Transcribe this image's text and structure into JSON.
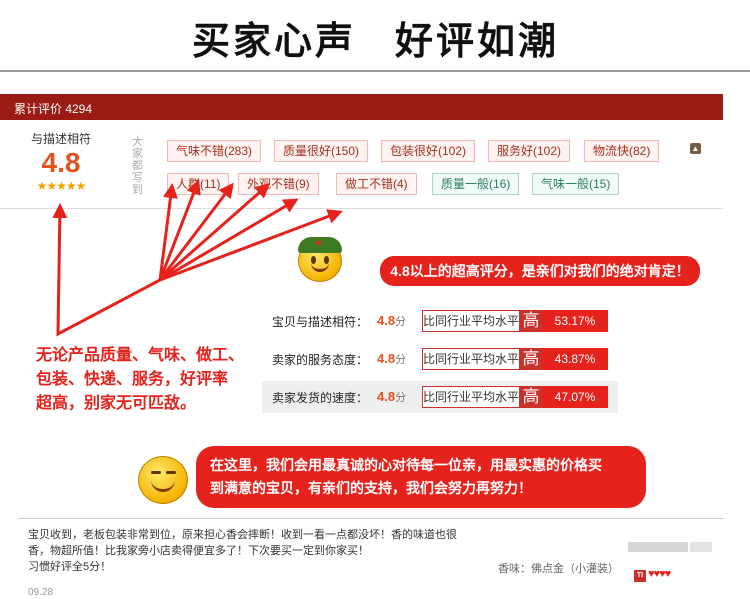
{
  "banner": {
    "title_left": "买家心声",
    "title_right": "好评如潮"
  },
  "rating_bar": {
    "label": "累计评价 4294"
  },
  "score": {
    "label": "与描述相符",
    "value": "4.8",
    "stars": "★★★★★"
  },
  "impressions": {
    "label": "大家都写到",
    "tags": [
      "气味不错(283)",
      "质量很好(150)",
      "包装很好(102)",
      "服务好(102)",
      "物流快(82)",
      "人群(11)",
      "外观不错(9)",
      "做工不错(4)",
      "质量一般(16)",
      "气味一般(15)"
    ]
  },
  "callout_top": "4.8以上的超高评分，是亲们对我们的绝对肯定！",
  "callout_left": [
    "无论产品质量、气味、做工、",
    "包装、快递、服务，好评率",
    "超高，别家无可匹敌。"
  ],
  "ratings": [
    {
      "label": "宝贝与描述相符：",
      "score": "4.8",
      "unit": "分",
      "compare": "比同行业平均水平",
      "level": "高",
      "pct": "53.17%"
    },
    {
      "label": "卖家的服务态度：",
      "score": "4.8",
      "unit": "分",
      "compare": "比同行业平均水平",
      "level": "高",
      "pct": "43.87%"
    },
    {
      "label": "卖家发货的速度：",
      "score": "4.8",
      "unit": "分",
      "compare": "比同行业平均水平",
      "level": "高",
      "pct": "47.07%"
    }
  ],
  "callout_bottom": [
    "在这里，我们会用最真诚的心对待每一位亲，用最实惠的价格买",
    "到满意的宝贝，有亲们的支持，我们会努力再努力！"
  ],
  "review": {
    "lines": [
      "宝贝收到，老板包装非常到位，原来担心香会摔断！收到一看一点都没坏！香的味道也很",
      "香，物超所值！比我家旁小店卖得便宜多了！下次要买一定到你家买！",
      "习惯好评全5分！"
    ],
    "date": "09.28",
    "attribute": "香味：佛点金（小灌装）",
    "badge": "TI",
    "hearts": "♥♥♥♥"
  },
  "colors": {
    "accent": "#e5221c",
    "bar": "#9b1b15",
    "score": "#e5511d"
  }
}
